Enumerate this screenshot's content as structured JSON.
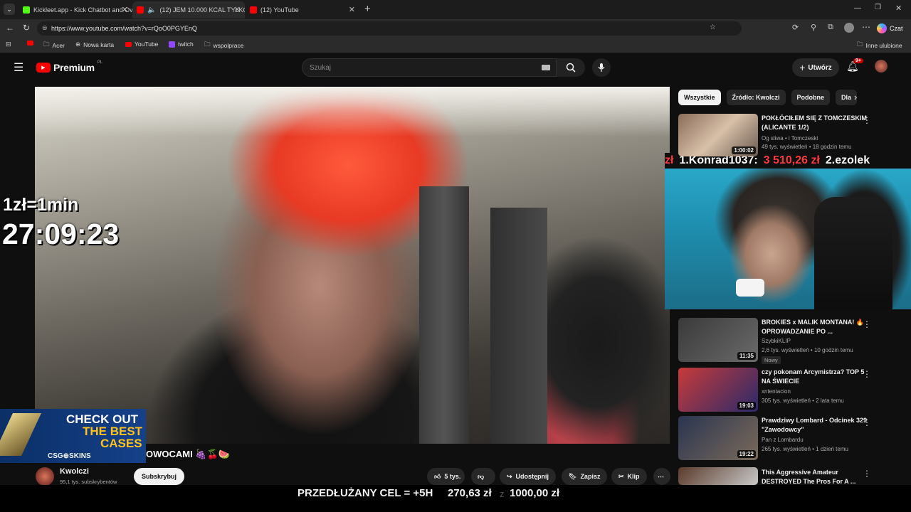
{
  "browser": {
    "tabs": [
      {
        "title": "Kickleet.app - Kick Chatbot and Ov",
        "active": false,
        "fav_color": "#53fc18"
      },
      {
        "title": "(12) JEM 10.000 KCAL TYLKO",
        "active": true,
        "fav_color": "#ff0000"
      },
      {
        "title": "(12) YouTube",
        "active": false,
        "fav_color": "#ff0000"
      }
    ],
    "url": "https://www.youtube.com/watch?v=rQoO0PGYEnQ",
    "copilot_label": "Czat",
    "favorites": [
      {
        "label": "",
        "icon": "youtube-icon"
      },
      {
        "label": "Acer",
        "icon": "folder-icon"
      },
      {
        "label": "Nowa karta",
        "icon": "globe-icon"
      },
      {
        "label": "YouTube",
        "icon": "youtube-icon"
      },
      {
        "label": "twitch",
        "icon": "twitch-icon"
      },
      {
        "label": "wspolprace",
        "icon": "folder-icon"
      }
    ],
    "other_favorites": "Inne ulubione"
  },
  "youtube": {
    "logo_text": "Premium",
    "logo_region": "PL",
    "search_placeholder": "Szukaj",
    "create_label": "Utwórz",
    "notif_count": "9+",
    "chips": [
      "Wszystkie",
      "Źródło: Kwolczi",
      "Podobne",
      "Dla"
    ],
    "channel": {
      "name": "Kwolczi",
      "subs": "95,1 tys. subskrybentów",
      "subscribe": "Subskrybuj"
    },
    "video_title_partial": "OWOCAMI 🍇🍒🍉",
    "actions": {
      "likes": "5 tys.",
      "share": "Udostępnij",
      "save": "Zapisz",
      "clip": "Klip"
    },
    "recommendations": [
      {
        "title": "POKŁÓCIŁEM SIĘ Z TOMCZESKIM (ALICANTE 1/2)",
        "channel": "Og sliwa • i Tomczeski",
        "meta": "49 tys. wyświetleń • 18 godzin temu",
        "duration": "1:00:02",
        "badge": ""
      },
      {
        "title": "BROKIES x MALIK MONTANA! 🔥 OPROWADZANIE PO ...",
        "channel": "SzybkiKLIP",
        "meta": "2,6 tys. wyświetleń • 10 godzin temu",
        "duration": "11:35",
        "badge": "Nowy"
      },
      {
        "title": "czy pokonam Arcymistrza? TOP 5 NA ŚWIECIE",
        "channel": "xntentacion",
        "meta": "305 tys. wyświetleń • 2 lata temu",
        "duration": "19:03",
        "badge": ""
      },
      {
        "title": "Prawdziwy Lombard - Odcinek 329 \"Zawodowcy\"",
        "channel": "Pan z Lombardu",
        "meta": "265 tys. wyświetleń • 1 dzień temu",
        "duration": "19:22",
        "badge": ""
      },
      {
        "title": "This Aggressive Amateur DESTROYED The Pros For A ...",
        "channel": "",
        "meta": "",
        "duration": "",
        "badge": ""
      }
    ]
  },
  "overlay": {
    "rate": "1zł=1min",
    "timer": "27:09:23",
    "leaderboard": [
      "zł",
      "1.Konrad1037:",
      "3 510,26 zł",
      "2.ezolek"
    ],
    "ad_line1": "CHECK OUT",
    "ad_line2": "THE BEST",
    "ad_line3": "CASES",
    "ad_brand": "CSG⊕SKINS",
    "goal_label": "PRZEDŁUŻANY CEL = +5H",
    "goal_current": "270,63 zł",
    "goal_sep": "z",
    "goal_target": "1000,00 zł"
  },
  "colors": {
    "accent_red": "#ff0000",
    "leader_red": "#ff3b3b",
    "bg": "#0f0f0f"
  }
}
